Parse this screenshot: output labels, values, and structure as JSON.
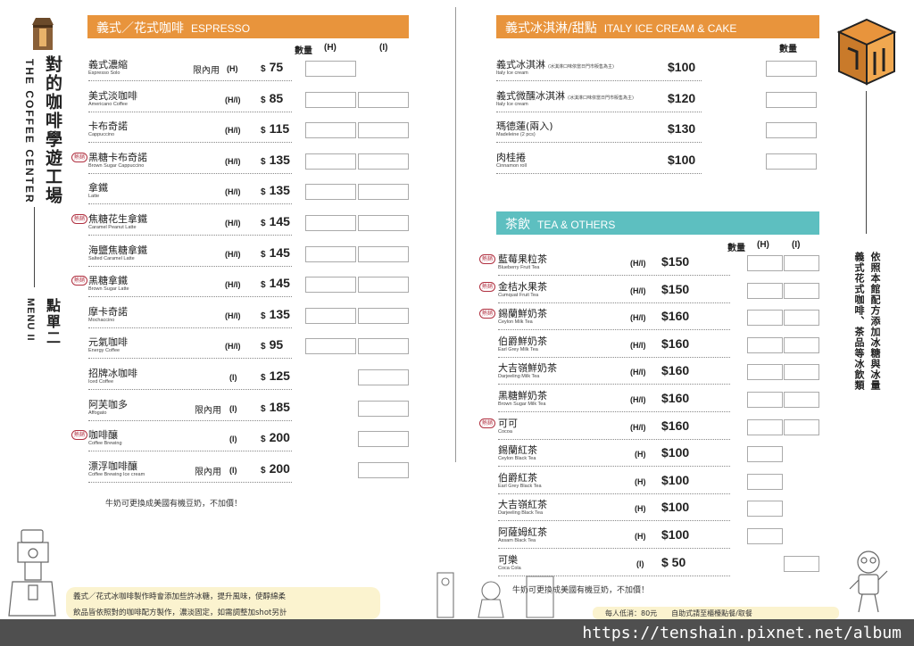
{
  "brand": {
    "chinese": "對的咖啡學遊工場",
    "english": "THE COFFEE CENTER",
    "menu_cn": "點單二",
    "menu_en": "MENU II"
  },
  "espresso": {
    "title_cn": "義式／花式咖啡",
    "title_en": "ESPRESSO",
    "col_qty": "數量",
    "col_h": "(H)",
    "col_i": "(I)",
    "items": [
      {
        "hot": "",
        "name": "義式濃縮",
        "en": "Espresso Solo",
        "limit": "限內用",
        "size": "(H)",
        "dollar": "$",
        "price": "75",
        "boxes": 1
      },
      {
        "hot": "",
        "name": "美式淡咖啡",
        "en": "Americano Coffee",
        "limit": "",
        "size": "(H/I)",
        "dollar": "$",
        "price": "85",
        "boxes": 2
      },
      {
        "hot": "",
        "name": "卡布奇諾",
        "en": "Cappuccino",
        "limit": "",
        "size": "(H/I)",
        "dollar": "$",
        "price": "115",
        "boxes": 2
      },
      {
        "hot": "熱銷",
        "name": "黑糖卡布奇諾",
        "en": "Brown Sugar Cappuccino",
        "limit": "",
        "size": "(H/I)",
        "dollar": "$",
        "price": "135",
        "boxes": 2
      },
      {
        "hot": "",
        "name": "拿鐵",
        "en": "Latte",
        "limit": "",
        "size": "(H/I)",
        "dollar": "$",
        "price": "135",
        "boxes": 2
      },
      {
        "hot": "熱銷",
        "name": "焦糖花生拿鐵",
        "en": "Caramel Peanut Latte",
        "limit": "",
        "size": "(H/I)",
        "dollar": "$",
        "price": "145",
        "boxes": 2
      },
      {
        "hot": "",
        "name": "海鹽焦糖拿鐵",
        "en": "Salted Caramel Latte",
        "limit": "",
        "size": "(H/I)",
        "dollar": "$",
        "price": "145",
        "boxes": 2
      },
      {
        "hot": "熱銷",
        "name": "黑糖拿鐵",
        "en": "Brown Sugar Latte",
        "limit": "",
        "size": "(H/I)",
        "dollar": "$",
        "price": "145",
        "boxes": 2
      },
      {
        "hot": "",
        "name": "摩卡奇諾",
        "en": "Mochaccino",
        "limit": "",
        "size": "(H/I)",
        "dollar": "$",
        "price": "135",
        "boxes": 2
      },
      {
        "hot": "",
        "name": "元氣咖啡",
        "en": "Energy Coffee",
        "limit": "",
        "size": "(H/I)",
        "dollar": "$",
        "price": "95",
        "boxes": 2
      },
      {
        "hot": "",
        "name": "招牌冰咖啡",
        "en": "Iced Coffee",
        "limit": "",
        "size": "(I)",
        "dollar": "$",
        "price": "125",
        "boxes": 0
      },
      {
        "hot": "",
        "name": "阿芙咖多",
        "en": "Affogato",
        "limit": "限內用",
        "size": "(I)",
        "dollar": "$",
        "price": "185",
        "boxes": 0
      },
      {
        "hot": "熱銷",
        "name": "咖啡釀",
        "en": "Coffee Brewing",
        "limit": "",
        "size": "(I)",
        "dollar": "$",
        "price": "200",
        "boxes": 0
      },
      {
        "hot": "",
        "name": "漂浮咖啡釀",
        "en": "Coffee Brewing Ice cream",
        "limit": "限內用",
        "size": "(I)",
        "dollar": "$",
        "price": "200",
        "boxes": 0
      }
    ],
    "note": "牛奶可更換成美國有機豆奶，不加價！"
  },
  "icecream": {
    "title_cn": "義式冰淇淋/甜點",
    "title_en": "ITALY ICE CREAM & CAKE",
    "col_qty": "數量",
    "items": [
      {
        "name": "義式冰淇淋",
        "tiny": "(冰淇淋口味依當日門市販售為主)",
        "en": "Italy Ice cream",
        "price": "$100"
      },
      {
        "name": "義式微醺冰淇淋",
        "tiny": "(冰淇淋口味依當日門市販售為主)",
        "en": "Italy Ice cream",
        "price": "$120"
      },
      {
        "name": "瑪德蓮(兩入)",
        "tiny": "",
        "en": "Madeleine (2 pcs)",
        "price": "$130"
      },
      {
        "name": "肉桂捲",
        "tiny": "",
        "en": "Cinnamon roll",
        "price": "$100"
      }
    ]
  },
  "tea": {
    "title_cn": "茶飲",
    "title_en": "TEA & OTHERS",
    "col_qty": "數量",
    "col_h": "(H)",
    "col_i": "(I)",
    "items": [
      {
        "hot": "熱銷",
        "name": "藍莓果粒茶",
        "en": "Blueberry Fruit Tea",
        "size": "(H/I)",
        "price": "$150",
        "boxes": 2
      },
      {
        "hot": "熱銷",
        "name": "金桔水果茶",
        "en": "Cumquat Fruit Tea",
        "size": "(H/I)",
        "price": "$150",
        "boxes": 2
      },
      {
        "hot": "熱銷",
        "name": "錫蘭鮮奶茶",
        "en": "Ceylon Milk Tea",
        "size": "(H/I)",
        "price": "$160",
        "boxes": 2
      },
      {
        "hot": "",
        "name": "伯爵鮮奶茶",
        "en": "Earl Grey Milk Tea",
        "size": "(H/I)",
        "price": "$160",
        "boxes": 2
      },
      {
        "hot": "",
        "name": "大吉嶺鮮奶茶",
        "en": "Darjeeling Milk Tea",
        "size": "(H/I)",
        "price": "$160",
        "boxes": 2
      },
      {
        "hot": "",
        "name": "黑糖鮮奶茶",
        "en": "Brown Sugar Milk Tea",
        "size": "(H/I)",
        "price": "$160",
        "boxes": 2
      },
      {
        "hot": "熱銷",
        "name": "可可",
        "en": "Cocoa",
        "size": "(H/I)",
        "price": "$160",
        "boxes": 2
      },
      {
        "hot": "",
        "name": "錫蘭紅茶",
        "en": "Ceylon Black Tea",
        "size": "(H)",
        "price": "$100",
        "boxes": 1
      },
      {
        "hot": "",
        "name": "伯爵紅茶",
        "en": "Earl Grey Black Tea",
        "size": "(H)",
        "price": "$100",
        "boxes": 1
      },
      {
        "hot": "",
        "name": "大吉嶺紅茶",
        "en": "Darjeeling Black Tea",
        "size": "(H)",
        "price": "$100",
        "boxes": 1
      },
      {
        "hot": "",
        "name": "阿薩姆紅茶",
        "en": "Assam Black Tea",
        "size": "(H)",
        "price": "$100",
        "boxes": 1
      },
      {
        "hot": "",
        "name": "可樂",
        "en": "Coca Cola",
        "size": "(I)",
        "price": "$ 50",
        "boxes": 3
      }
    ],
    "note": "牛奶可更換成美國有機豆奶，不加價！"
  },
  "side_note": {
    "line1": "依照本館配方添加冰糖與冰量",
    "line2": "義式花式咖啡、茶品等冰飲類"
  },
  "bottom_note": {
    "line1": "義式／花式冰咖啡製作時會添加些許冰糖，提升風味，使醇綿柔",
    "line2": "飲品皆依照對的咖啡配方製作，濃淡固定，如需調整加shot另計"
  },
  "min_charge": "每人低消：80元　　自助式請至櫃檯點餐/取餐",
  "watermark": "https://tenshain.pixnet.net/album",
  "colors": {
    "espresso_header": "#e8943c",
    "tea_header": "#5dbfc0",
    "hot_badge": "#b03040"
  }
}
